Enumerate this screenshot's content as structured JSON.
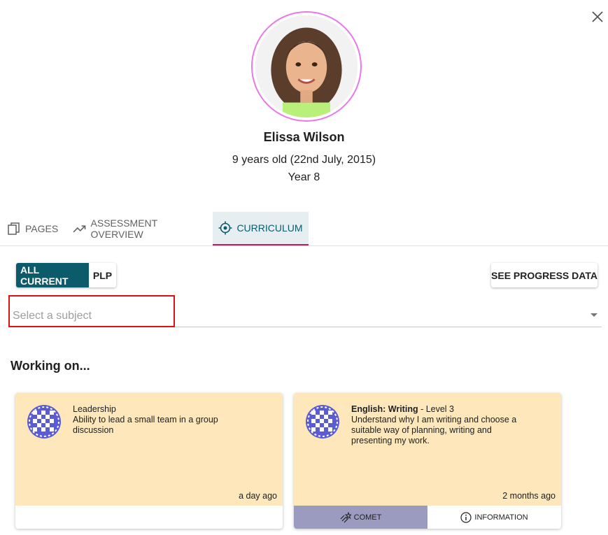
{
  "student": {
    "name": "Elissa Wilson",
    "age_line": "9 years old (22nd July, 2015)",
    "year": "Year 8"
  },
  "tabs": [
    {
      "label": "PAGES",
      "icon": "pages-icon"
    },
    {
      "label": "ASSESSMENT OVERVIEW",
      "icon": "trending-up-icon"
    },
    {
      "label": "CURRICULUM",
      "icon": "target-icon",
      "active": true
    }
  ],
  "filters": {
    "all_current": "ALL CURRENT",
    "plp": "PLP",
    "see_progress": "SEE PROGRESS DATA"
  },
  "subject_select": {
    "placeholder": "Select a subject"
  },
  "section": {
    "title": "Working on..."
  },
  "cards": [
    {
      "subject": "Leadership",
      "level": "",
      "description": "Ability to lead a small team in a group discussion",
      "time": "a day ago",
      "icon": "pattern-badge-icon"
    },
    {
      "subject": "English: Writing",
      "level": " - Level 3",
      "description": "Understand why I am writing and choose a suitable way of planning, writing and presenting my work.",
      "time": "2 months ago",
      "icon": "pattern-badge-icon",
      "comet_label": "COMET",
      "info_label": "INFORMATION"
    }
  ],
  "colors": {
    "accent": "#0b5b6b",
    "tab_underline": "#c2185b",
    "card_bg": "#fde7bb",
    "comet_bg": "#9b9bbf",
    "avatar_ring": "#e879e8",
    "highlight": "#e01010"
  }
}
